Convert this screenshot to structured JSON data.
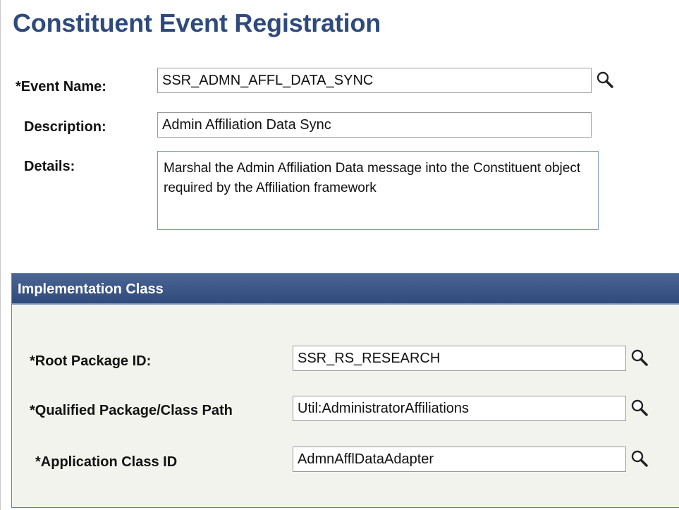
{
  "page": {
    "title": "Constituent Event Registration"
  },
  "form": {
    "event_name": {
      "label": "*Event Name:",
      "value": "SSR_ADMN_AFFL_DATA_SYNC"
    },
    "description": {
      "label": "Description:",
      "value": "Admin Affiliation Data Sync"
    },
    "details": {
      "label": "Details:",
      "value": "Marshal the Admin Affiliation Data message into the Constituent object required by the Affiliation framework"
    }
  },
  "implementation_class": {
    "title": "Implementation Class",
    "root_package_id": {
      "label": "*Root Package ID:",
      "value": "SSR_RS_RESEARCH"
    },
    "qualified_path": {
      "label": "*Qualified Package/Class Path",
      "value": "Util:AdministratorAffiliations"
    },
    "application_class_id": {
      "label": "*Application Class ID",
      "value": "AdmnAfflDataAdapter"
    }
  },
  "icons": {
    "lookup": "magnifying-glass-icon"
  },
  "colors": {
    "title": "#2f4a7c",
    "section_header": "#3d5689",
    "section_bg": "#f3f3ee"
  }
}
